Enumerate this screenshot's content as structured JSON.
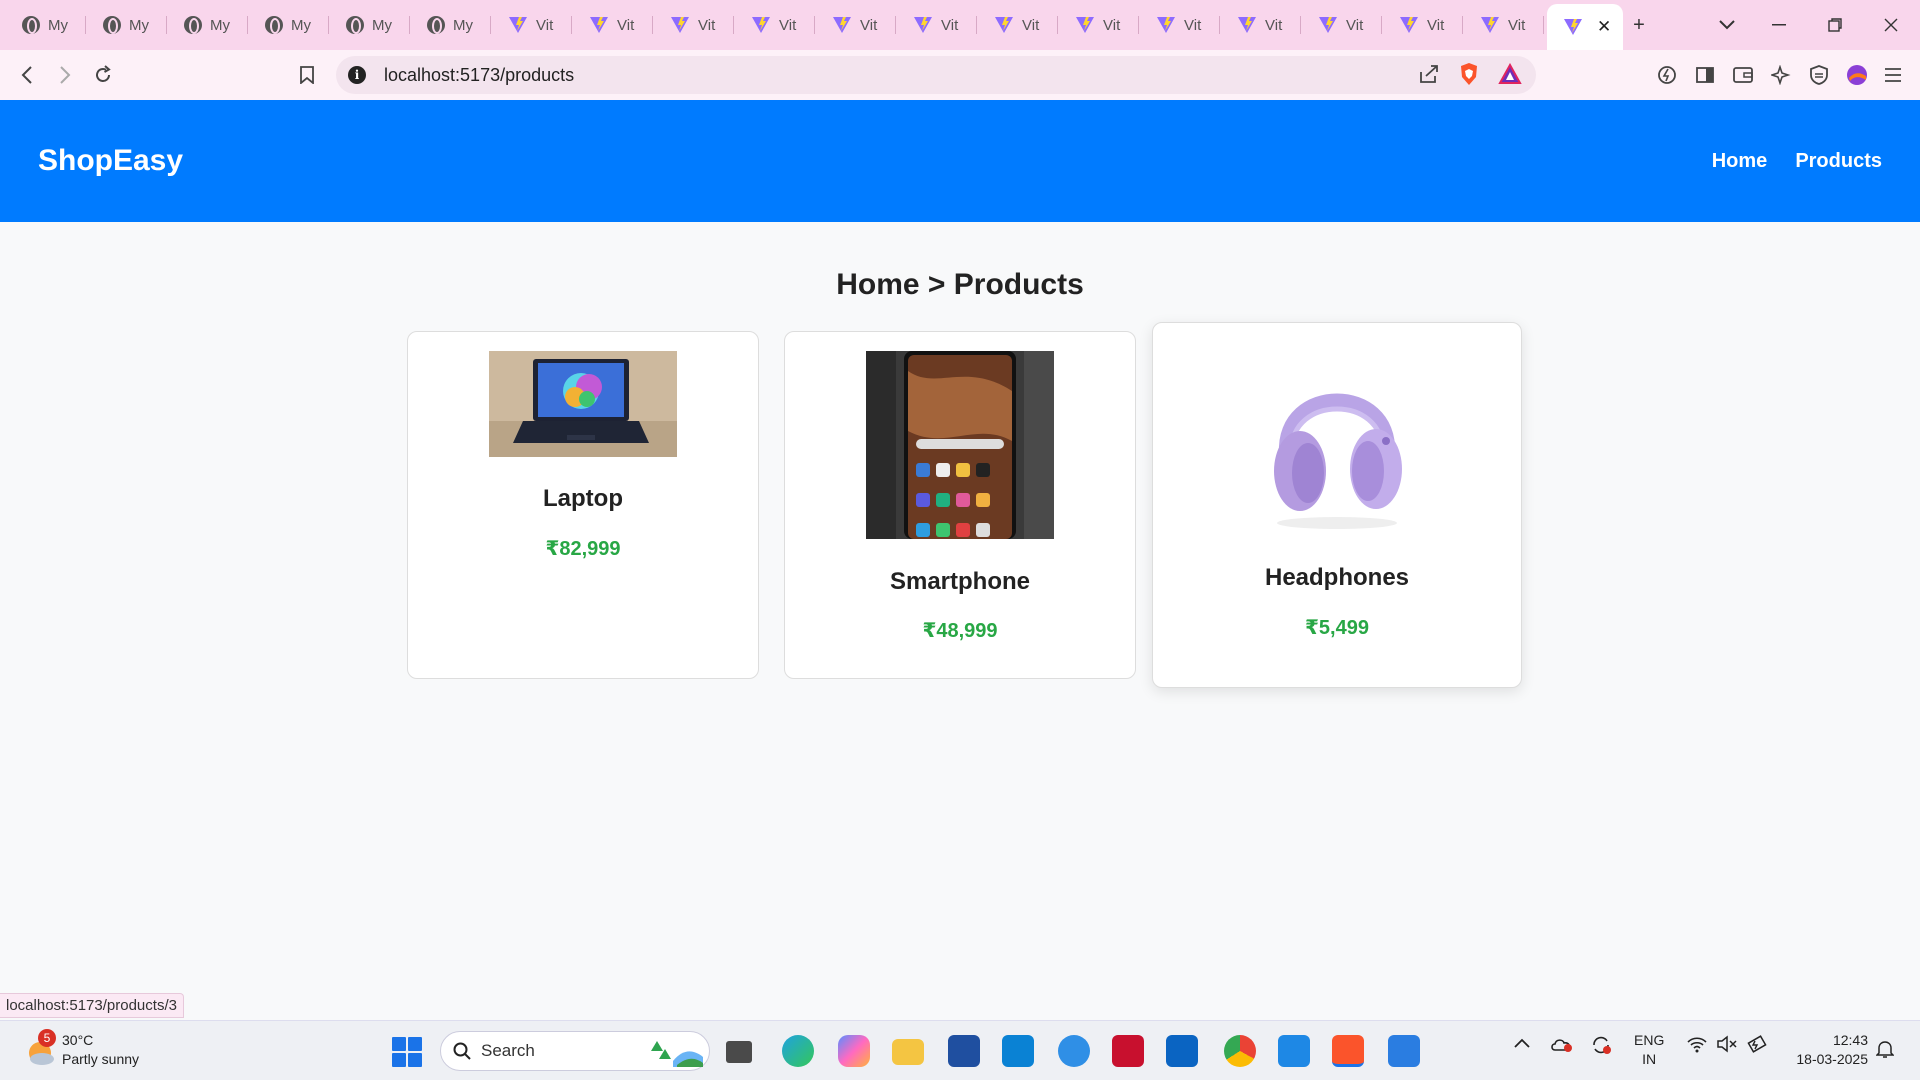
{
  "browser": {
    "tabs": [
      {
        "title": "My",
        "icon": "globe-icon"
      },
      {
        "title": "My",
        "icon": "globe-icon"
      },
      {
        "title": "My",
        "icon": "globe-icon"
      },
      {
        "title": "My",
        "icon": "globe-icon"
      },
      {
        "title": "My",
        "icon": "globe-icon"
      },
      {
        "title": "My",
        "icon": "globe-icon"
      },
      {
        "title": "Vit",
        "icon": "vite-icon"
      },
      {
        "title": "Vit",
        "icon": "vite-icon"
      },
      {
        "title": "Vit",
        "icon": "vite-icon"
      },
      {
        "title": "Vit",
        "icon": "vite-icon"
      },
      {
        "title": "Vit",
        "icon": "vite-icon"
      },
      {
        "title": "Vit",
        "icon": "vite-icon"
      },
      {
        "title": "Vit",
        "icon": "vite-icon"
      },
      {
        "title": "Vit",
        "icon": "vite-icon"
      },
      {
        "title": "Vit",
        "icon": "vite-icon"
      },
      {
        "title": "Vit",
        "icon": "vite-icon"
      },
      {
        "title": "Vit",
        "icon": "vite-icon"
      },
      {
        "title": "Vit",
        "icon": "vite-icon"
      },
      {
        "title": "Vit",
        "icon": "vite-icon"
      }
    ],
    "active_tab_close": "✕",
    "new_tab": "+",
    "url": "localhost:5173/products",
    "status_url": "localhost:5173/products/3"
  },
  "site": {
    "brand": "ShopEasy",
    "nav": {
      "home": "Home",
      "products": "Products"
    },
    "breadcrumb": "Home > Products",
    "products": [
      {
        "name": "Laptop",
        "price": "₹82,999"
      },
      {
        "name": "Smartphone",
        "price": "₹48,999"
      },
      {
        "name": "Headphones",
        "price": "₹5,499"
      }
    ]
  },
  "taskbar": {
    "weather_temp": "30°C",
    "weather_desc": "Partly sunny",
    "weather_badge": "5",
    "search_placeholder": "Search",
    "lang_1": "ENG",
    "lang_2": "IN",
    "time": "12:43",
    "date": "18-03-2025"
  },
  "colors": {
    "navbar": "#007bff",
    "price": "#28a745",
    "tabstrip": "#f9d6ec"
  }
}
